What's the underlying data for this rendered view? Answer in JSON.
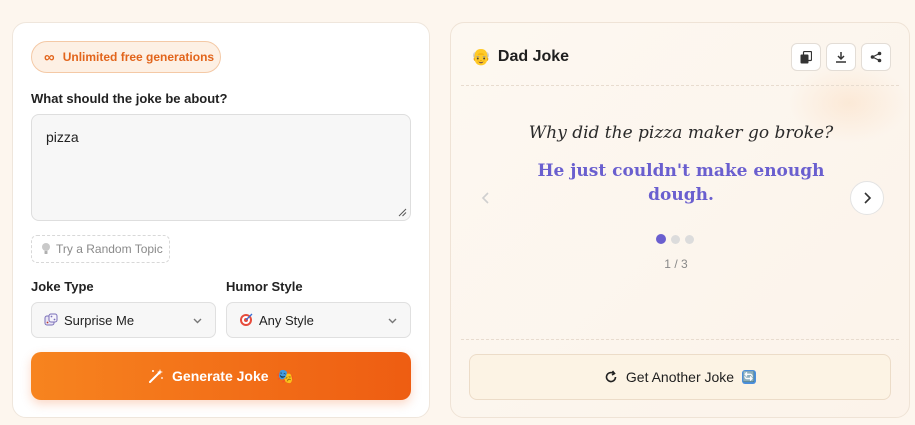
{
  "left": {
    "badge_icon": "∞",
    "badge": "Unlimited free generations",
    "topic_label": "What should the joke be about?",
    "topic_value": "pizza",
    "random_label": "Try a Random Topic",
    "joke_type_label": "Joke Type",
    "joke_type_value": "Surprise Me",
    "humor_label": "Humor Style",
    "humor_value": "Any Style",
    "generate_label": "Generate Joke",
    "generate_emoji": "🎭"
  },
  "right": {
    "title_emoji": "👴",
    "title": "Dad Joke",
    "setup": "Why did the pizza maker go broke?",
    "punchline": "He just couldn't make enough dough.",
    "page_current": "1",
    "page_sep": "/",
    "page_total": "3",
    "another_label": "Get Another Joke",
    "another_emoji": "🔄"
  },
  "icons": {
    "badge": "infinity-icon",
    "random": "lightbulb-icon",
    "joke_type": "dice-icon",
    "humor": "target-icon",
    "generate": "magic-wand-icon",
    "copy": "copy-icon",
    "download": "download-icon",
    "share": "share-icon",
    "prev": "chevron-left-icon",
    "next": "chevron-right-icon",
    "refresh": "refresh-icon"
  },
  "colors": {
    "accent_orange": "#ee5d12",
    "accent_purple": "#6a5fcf",
    "background": "#fdf6ee"
  }
}
